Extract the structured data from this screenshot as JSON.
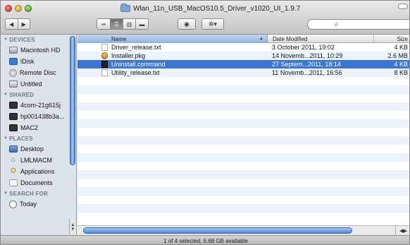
{
  "window": {
    "title": "Wlan_11n_USB_MacOS10.5_Driver_v1020_UI_1.9.7"
  },
  "toolbar": {
    "back_icon": "back-arrow-icon",
    "forward_icon": "forward-arrow-icon",
    "view_modes": [
      "icon",
      "list",
      "column",
      "coverflow"
    ],
    "active_view": "list",
    "quicklook_icon": "eye-icon",
    "action_icon": "gear-icon",
    "search_placeholder": ""
  },
  "sidebar": {
    "sections": [
      {
        "title": "DEVICES",
        "items": [
          {
            "label": "Macintosh HD",
            "icon": "hard-drive-icon"
          },
          {
            "label": "iDisk",
            "icon": "idisk-icon"
          },
          {
            "label": "Remote Disc",
            "icon": "disc-icon"
          },
          {
            "label": "Untitled",
            "icon": "drive-icon"
          }
        ]
      },
      {
        "title": "SHARED",
        "items": [
          {
            "label": "4com-21g615j",
            "icon": "computer-icon"
          },
          {
            "label": "hp001438b3a...",
            "icon": "computer-icon"
          },
          {
            "label": "MAC2",
            "icon": "computer-icon"
          }
        ]
      },
      {
        "title": "PLACES",
        "items": [
          {
            "label": "Desktop",
            "icon": "desktop-icon"
          },
          {
            "label": "LMLMACM",
            "icon": "home-icon"
          },
          {
            "label": "Applications",
            "icon": "applications-icon"
          },
          {
            "label": "Documents",
            "icon": "documents-icon"
          }
        ]
      },
      {
        "title": "SEARCH FOR",
        "items": [
          {
            "label": "Today",
            "icon": "clock-icon"
          }
        ]
      }
    ]
  },
  "columns": {
    "name": "Name",
    "date": "Date Modified",
    "size": "Size"
  },
  "files": [
    {
      "name": "Driver_release.txt",
      "date": "3 October 2011, 19:02",
      "size": "4 KB",
      "icon": "text-file-icon",
      "selected": false
    },
    {
      "name": "Installer.pkg",
      "date": "14 Novemb...2011, 10:29",
      "size": "2.6 MB",
      "icon": "package-icon",
      "selected": false
    },
    {
      "name": "Uninstall.command",
      "date": "27 Septem...2011, 18:14",
      "size": "4 KB",
      "icon": "command-file-icon",
      "selected": true
    },
    {
      "name": "Utility_release.txt",
      "date": "11 Novemb...2011, 16:56",
      "size": "8 KB",
      "icon": "text-file-icon",
      "selected": false
    }
  ],
  "status": "1 of 4 selected, 6.68 GB available",
  "colors": {
    "selection": "#3c76d0",
    "alt_row": "#edf3fe",
    "sidebar_bg": "#dde3ea"
  }
}
